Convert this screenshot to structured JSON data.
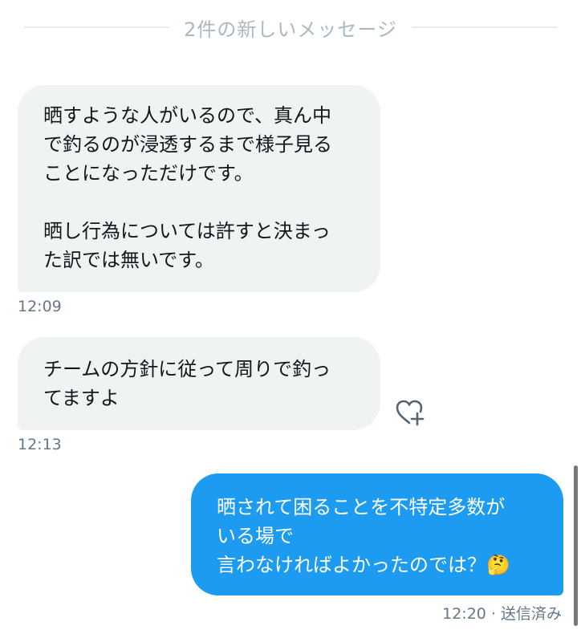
{
  "divider": {
    "label": "2件の新しいメッセージ"
  },
  "messages": [
    {
      "text": "晒すような人がいるので、真ん中\nで釣るのが浸透するまで様子見る\nことになっただけです。\n\n晒し行為については許すと決まっ\nた訳では無いです。",
      "time": "12:09"
    },
    {
      "text": "チームの方針に従って周りで釣っ\nてますよ",
      "time": "12:13"
    },
    {
      "text": "晒されて困ることを不特定多数が\nいる場で\n言わなければよかったのでは？🤔",
      "time": "12:20 · 送信済み"
    }
  ],
  "icons": {
    "reaction": "heart-plus-icon"
  },
  "colors": {
    "received_bubble": "#eff3f4",
    "sent_bubble": "#1d9bf0",
    "timestamp": "#657786",
    "divider_text": "#aab8c2"
  }
}
